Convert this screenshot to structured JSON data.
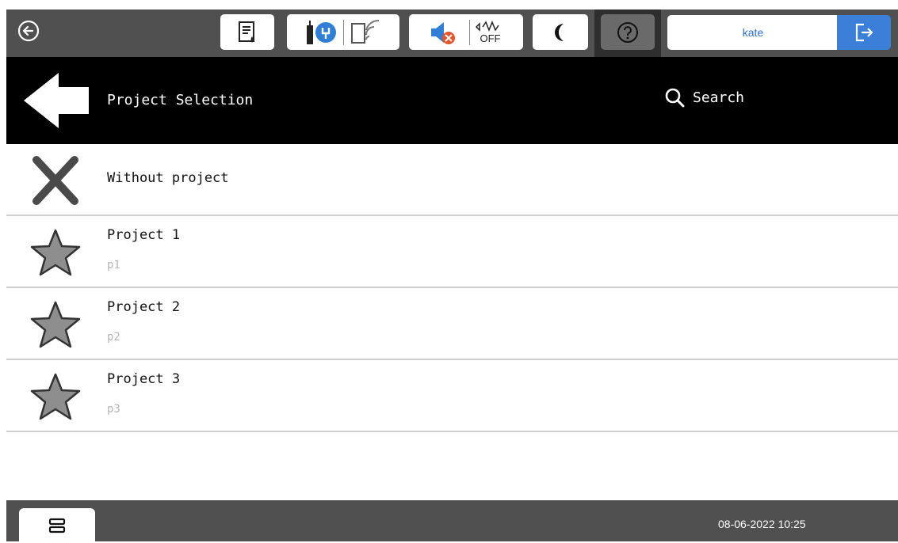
{
  "status_bar": {
    "user": "kate",
    "icons": [
      "back-circle-icon",
      "document-ink-icon",
      "printer-usb-icon",
      "wifi-direct-icon",
      "sound-muted-icon",
      "signal-off-icon",
      "moon-icon",
      "help-icon",
      "logout-icon"
    ],
    "signal_off_label": "OFF"
  },
  "header": {
    "title": "Project Selection",
    "search_label": "Search"
  },
  "list": {
    "items": [
      {
        "name": "Without project",
        "subtitle": "",
        "icon": "close-icon"
      },
      {
        "name": "Project 1",
        "subtitle": "p1",
        "icon": "star-icon"
      },
      {
        "name": "Project 2",
        "subtitle": "p2",
        "icon": "star-icon"
      },
      {
        "name": "Project 3",
        "subtitle": "p3",
        "icon": "star-icon"
      }
    ]
  },
  "footer": {
    "datetime": "08-06-2022 10:25"
  },
  "colors": {
    "status_bar_bg": "#505050",
    "header_bg": "#000000",
    "accent_blue": "#3b7fd9",
    "user_text": "#2f6fd0"
  }
}
